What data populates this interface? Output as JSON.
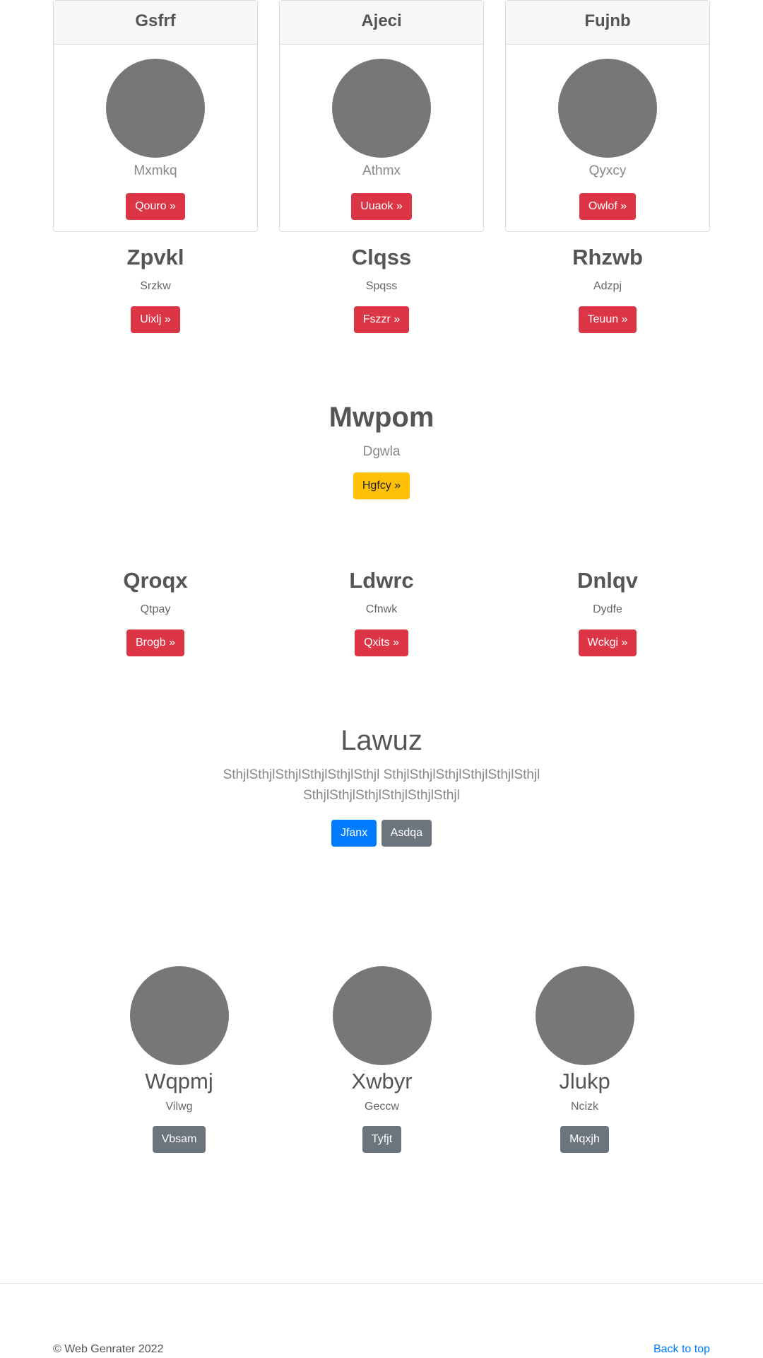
{
  "cards": [
    {
      "title": "Gsfrf",
      "subtitle": "Mxmkq",
      "button": "Qouro »"
    },
    {
      "title": "Ajeci",
      "subtitle": "Athmx",
      "button": "Uuaok »"
    },
    {
      "title": "Fujnb",
      "subtitle": "Qyxcy",
      "button": "Owlof »"
    }
  ],
  "row1": [
    {
      "title": "Zpvkl",
      "subtitle": "Srzkw",
      "button": "Uixlj »"
    },
    {
      "title": "Clqss",
      "subtitle": "Spqss",
      "button": "Fszzr »"
    },
    {
      "title": "Rhzwb",
      "subtitle": "Adzpj",
      "button": "Teuun »"
    }
  ],
  "feature": {
    "title": "Mwpom",
    "subtitle": "Dgwla",
    "button": "Hgfcy »"
  },
  "row2": [
    {
      "title": "Qroqx",
      "subtitle": "Qtpay",
      "button": "Brogb »"
    },
    {
      "title": "Ldwrc",
      "subtitle": "Cfnwk",
      "button": "Qxits »"
    },
    {
      "title": "Dnlqv",
      "subtitle": "Dydfe",
      "button": "Wckgi »"
    }
  ],
  "jumbotron": {
    "title": "Lawuz",
    "lead": "SthjlSthjlSthjlSthjlSthjlSthjl SthjlSthjlSthjlSthjlSthjlSthjl SthjlSthjlSthjlSthjlSthjlSthjl",
    "primary_button": "Jfanx",
    "secondary_button": "Asdqa"
  },
  "team": [
    {
      "name": "Wqpmj",
      "subtitle": "Vilwg",
      "button": "Vbsam"
    },
    {
      "name": "Xwbyr",
      "subtitle": "Geccw",
      "button": "Tyfjt"
    },
    {
      "name": "Jlukp",
      "subtitle": "Ncizk",
      "button": "Mqxjh"
    }
  ],
  "footer": {
    "copyright": "© Web Genrater 2022",
    "back_to_top": "Back to top"
  },
  "colors": {
    "danger": "#dc3545",
    "warning": "#ffc107",
    "primary": "#007bff",
    "secondary": "#6c757d",
    "placeholder": "#777777"
  }
}
